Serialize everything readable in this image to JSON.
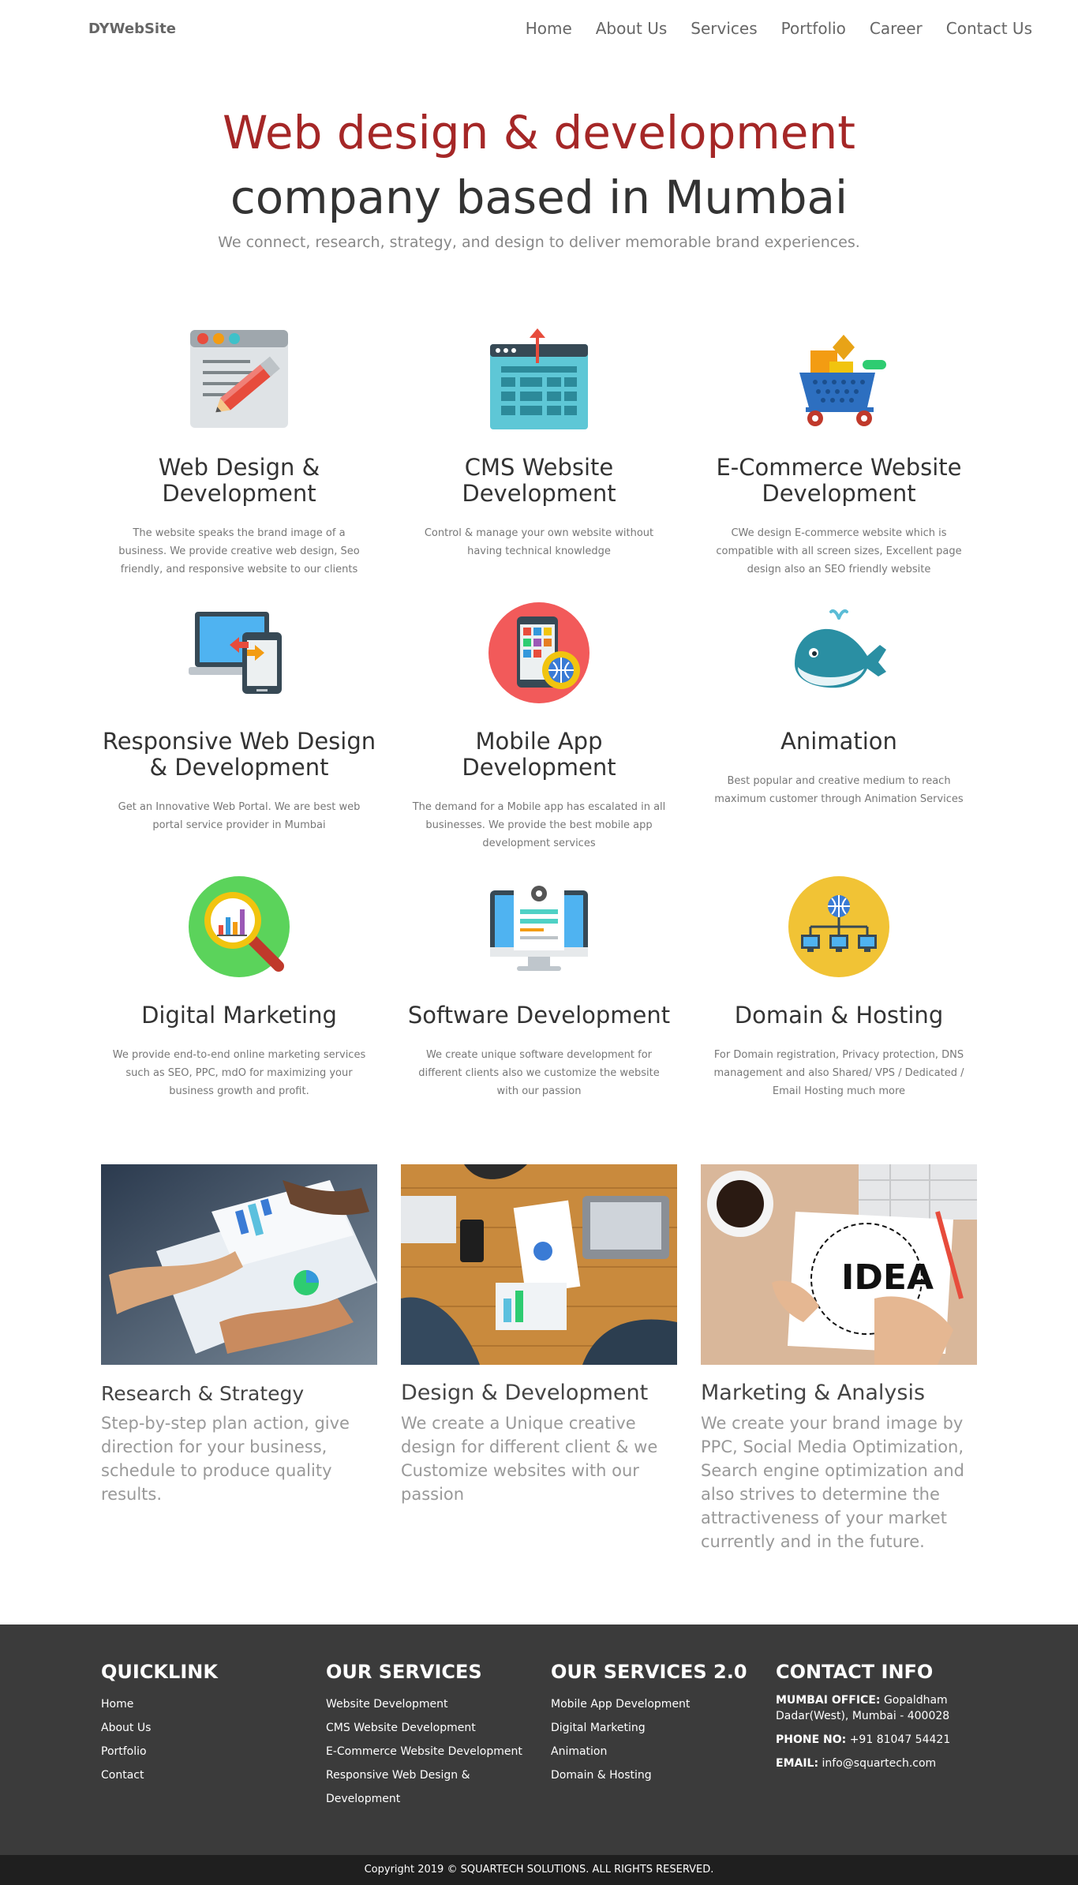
{
  "brand": "DYWebSite",
  "nav": [
    {
      "label": "Home"
    },
    {
      "label": "About Us"
    },
    {
      "label": "Services"
    },
    {
      "label": "Portfolio"
    },
    {
      "label": "Career"
    },
    {
      "label": "Contact Us"
    }
  ],
  "hero": {
    "title": "Web design & development",
    "subtitle": "company based in Mumbai",
    "tagline": "We connect, research, strategy, and design to deliver memorable brand experiences."
  },
  "services": [
    {
      "title": "Web Design & Development",
      "desc": "The website speaks the brand image of a business. We provide creative web design, Seo friendly, and responsive website to our clients",
      "icon": "web-design-icon"
    },
    {
      "title": "CMS Website Development",
      "desc": "Control & manage your own website without having technical knowledge",
      "icon": "cms-icon"
    },
    {
      "title": "E-Commerce Website Development",
      "desc": "CWe design E-commerce website which is compatible with all screen sizes, Excellent page design also an SEO friendly website",
      "icon": "ecommerce-cart-icon"
    },
    {
      "title": "Responsive Web Design & Development",
      "desc": "Get an Innovative Web Portal. We are best web portal service provider in Mumbai",
      "icon": "responsive-devices-icon"
    },
    {
      "title": "Mobile App Development",
      "desc": "The demand for a Mobile app has escalated in all businesses. We provide the best mobile app development services",
      "icon": "mobile-app-icon"
    },
    {
      "title": "Animation",
      "desc": "Best popular and creative medium to reach maximum customer through Animation Services",
      "icon": "whale-icon"
    },
    {
      "title": "Digital Marketing",
      "desc": "We provide end-to-end online marketing services such as SEO, PPC, mdO for maximizing your business growth and profit.",
      "icon": "magnifier-chart-icon"
    },
    {
      "title": "Software Development",
      "desc": "We create unique software development for different clients also we customize the website with our passion",
      "icon": "monitor-gear-icon"
    },
    {
      "title": "Domain & Hosting",
      "desc": "For Domain registration, Privacy protection, DNS management and also Shared/ VPS / Dedicated / Email Hosting much more",
      "icon": "network-globe-icon"
    }
  ],
  "features": [
    {
      "title": "Research & Strategy",
      "desc": "Step-by-step plan action, give direction for your business, schedule to produce quality results.",
      "image": "research-photo"
    },
    {
      "title": "Design & Development",
      "desc": "We create a Unique creative design for different client & we Customize websites with our passion",
      "image": "design-photo"
    },
    {
      "title": "Marketing & Analysis",
      "desc": "We create your brand image by PPC, Social Media Optimization, Search engine optimization and also strives to determine the attractiveness of your market currently and in the future.",
      "image": "idea-photo"
    }
  ],
  "footer": {
    "quicklink": {
      "heading": "QUICKLINK",
      "items": [
        "Home",
        "About Us",
        "Portfolio",
        "Contact"
      ]
    },
    "services": {
      "heading": "OUR SERVICES",
      "items": [
        "Website Development",
        "CMS Website Development",
        "E-Commerce Website Development",
        "Responsive Web Design &",
        "Development"
      ]
    },
    "services2": {
      "heading": "OUR SERVICES 2.0",
      "items": [
        "Mobile App Development",
        "Digital Marketing",
        "Animation",
        "Domain & Hosting"
      ]
    },
    "contact": {
      "heading": "CONTACT INFO",
      "office_label": "MUMBAI OFFICE:",
      "office_value": "Gopaldham Dadar(West), Mumbai - 400028",
      "phone_label": "PHONE NO:",
      "phone_value": "+91 81047 54421",
      "email_label": "EMAIL:",
      "email_value": "info@squartech.com"
    }
  },
  "copyright": "Copyright 2019 © SQUARTECH SOLUTIONS. ALL RIGHTS RESERVED."
}
